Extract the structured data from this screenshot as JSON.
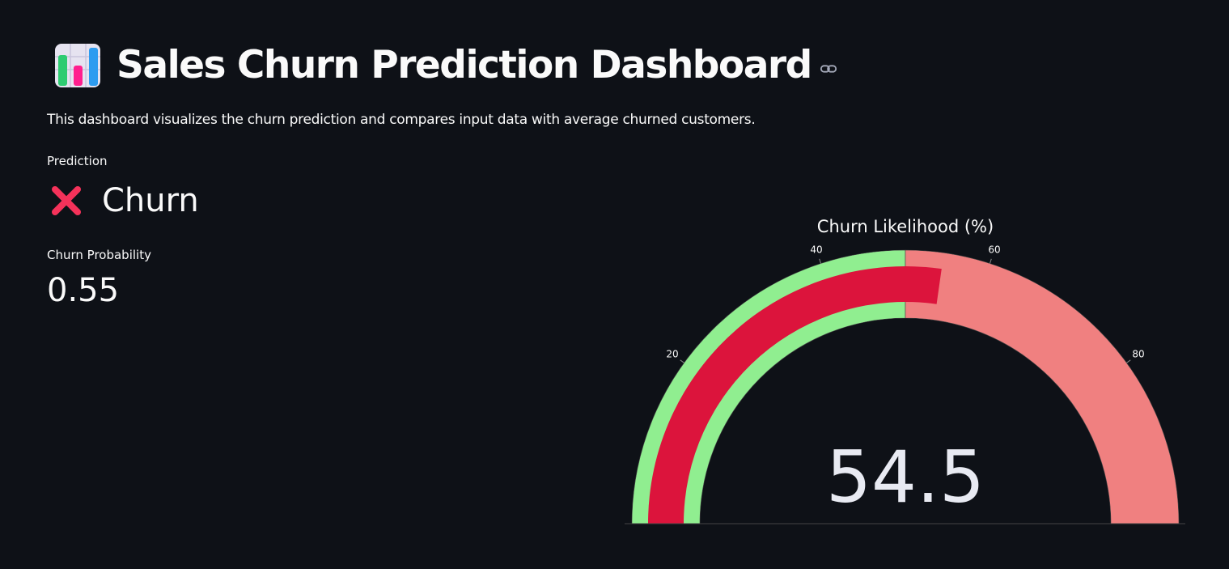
{
  "header": {
    "emoji_icon": "bar-chart-icon",
    "title": "Sales Churn Prediction Dashboard",
    "anchor_icon": "link-icon"
  },
  "description": "This dashboard visualizes the churn prediction and compares input data with average churned customers.",
  "metrics": {
    "prediction": {
      "label": "Prediction",
      "icon": "cross-mark-icon",
      "value": "Churn"
    },
    "probability": {
      "label": "Churn Probability",
      "value": "0.55"
    }
  },
  "chart_data": {
    "type": "gauge",
    "title": "Churn Likelihood (%)",
    "value": 54.5,
    "value_label": "54.5",
    "range": [
      0,
      100
    ],
    "ticks": [
      20,
      40,
      60,
      80
    ],
    "steps": [
      {
        "range": [
          0,
          50
        ],
        "color": "#90ee90"
      },
      {
        "range": [
          50,
          100
        ],
        "color": "#f08080"
      }
    ],
    "bar_color": "#dc143c"
  }
}
